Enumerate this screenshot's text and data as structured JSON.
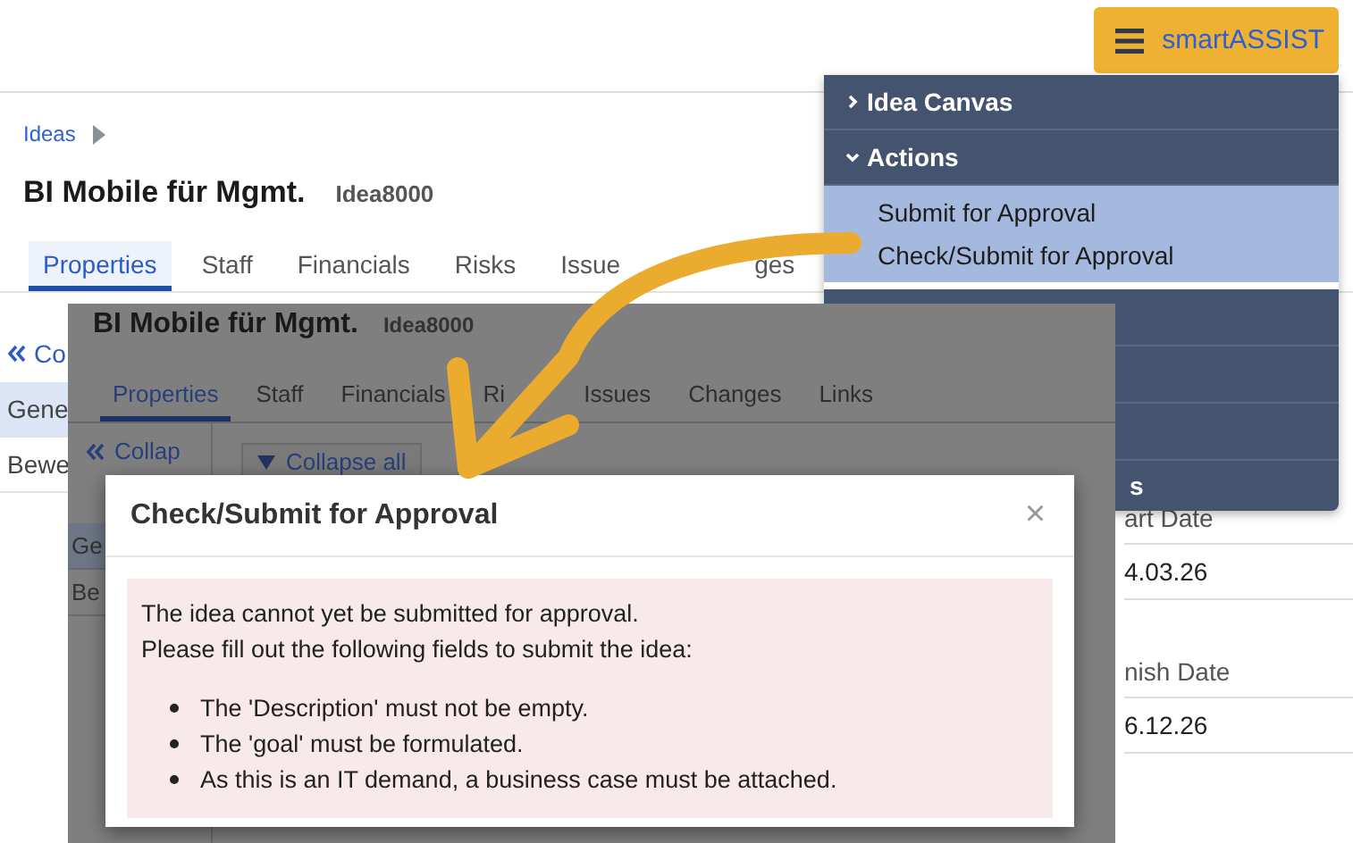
{
  "header": {
    "assist_button": {
      "label": "smartASSIST"
    }
  },
  "breadcrumb": [
    {
      "label": "Ideas"
    }
  ],
  "page": {
    "title": "BI Mobile für Mgmt.",
    "idea_id": "Idea8000"
  },
  "tabs": [
    {
      "label": "Properties",
      "selected": true
    },
    {
      "label": "Staff",
      "selected": false
    },
    {
      "label": "Financials",
      "selected": false
    },
    {
      "label": "Risks",
      "selected": false
    },
    {
      "label": "Issue",
      "selected": false
    },
    {
      "label": "ges",
      "selected": false
    }
  ],
  "side_nav": {
    "collapse_label": "Co",
    "items": [
      {
        "label": "Gene",
        "selected": true
      },
      {
        "label": "Bewe",
        "selected": false
      }
    ]
  },
  "fields": [
    {
      "label": "art Date",
      "value": "4.03.26"
    },
    {
      "label": "nish Date",
      "value": "6.12.26"
    }
  ],
  "assist_menu": {
    "sections": [
      {
        "label": "Idea Canvas",
        "expanded": false
      },
      {
        "label": "Actions",
        "expanded": true,
        "items": [
          {
            "label": "Submit for Approval"
          },
          {
            "label": "Check/Submit for Approval"
          }
        ]
      }
    ],
    "last_row": {
      "label": "s"
    }
  },
  "inset_screen": {
    "title": "BI Mobile für Mgmt.",
    "idea_id": "Idea8000",
    "tabs": [
      {
        "label": "Properties",
        "selected": true
      },
      {
        "label": "Staff",
        "selected": false
      },
      {
        "label": "Financials",
        "selected": false
      },
      {
        "label": "Ri",
        "selected": false
      },
      {
        "label": "Issues",
        "selected": false
      },
      {
        "label": "Changes",
        "selected": false
      },
      {
        "label": "Links",
        "selected": false
      }
    ],
    "collapse_label": "Collap",
    "collapse_all": "Collapse all",
    "nav_items": [
      {
        "label": "Ge",
        "selected": true
      },
      {
        "label": "Be",
        "selected": false
      }
    ]
  },
  "dialog": {
    "title": "Check/Submit for Approval",
    "close": "×",
    "message": [
      "The idea cannot yet be submitted for approval.",
      "Please fill out the following fields to submit the idea:"
    ],
    "bullets": [
      "The 'Description' must not be empty.",
      "The 'goal' must be formulated.",
      "As this is an IT demand, a business case must be attached."
    ]
  }
}
